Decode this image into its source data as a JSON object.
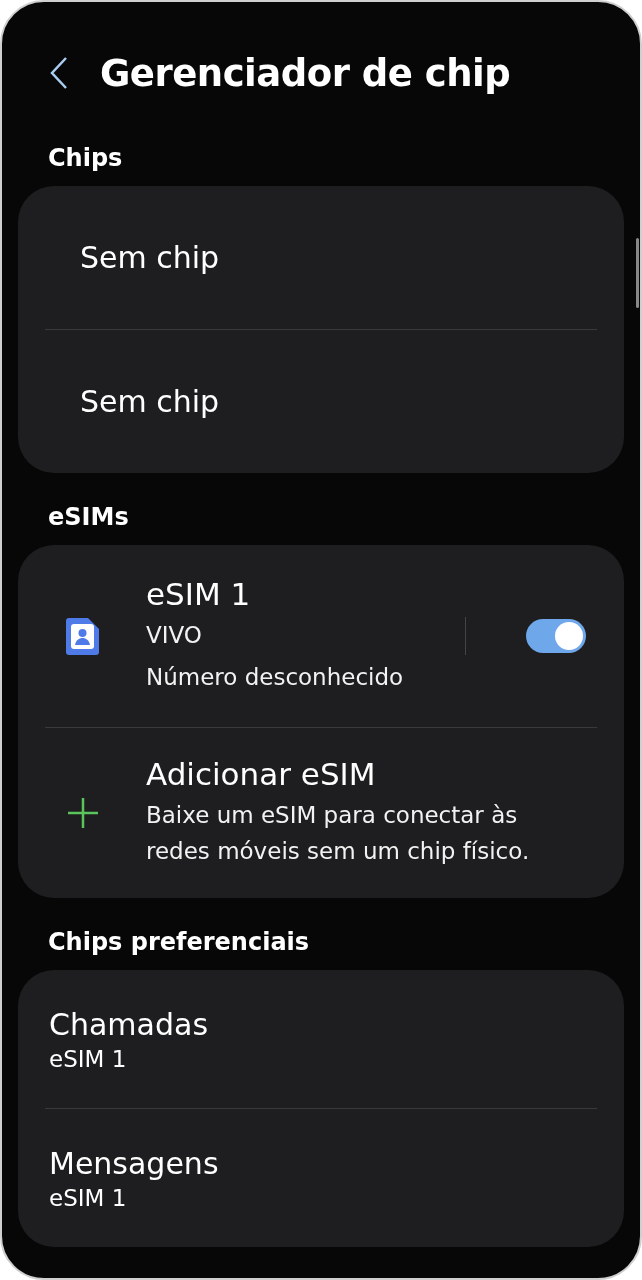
{
  "header": {
    "title": "Gerenciador de chip"
  },
  "sections": [
    {
      "title": "Chips",
      "items": [
        {
          "kind": "plain",
          "title": "Sem chip"
        },
        {
          "kind": "plain",
          "title": "Sem chip"
        }
      ]
    },
    {
      "title": "eSIMs",
      "items": [
        {
          "kind": "esim",
          "title": "eSIM 1",
          "lines": [
            "VIVO",
            "Número desconhecido"
          ],
          "on": true
        },
        {
          "kind": "add",
          "title": "Adicionar eSIM",
          "lines": [
            "Baixe um eSIM para conectar às redes móveis sem um chip físico."
          ]
        }
      ]
    },
    {
      "title": "Chips preferenciais",
      "items": [
        {
          "kind": "pref",
          "title": "Chamadas",
          "lines": [
            "eSIM 1"
          ]
        },
        {
          "kind": "pref",
          "title": "Mensagens",
          "lines": [
            "eSIM 1"
          ]
        }
      ]
    }
  ]
}
